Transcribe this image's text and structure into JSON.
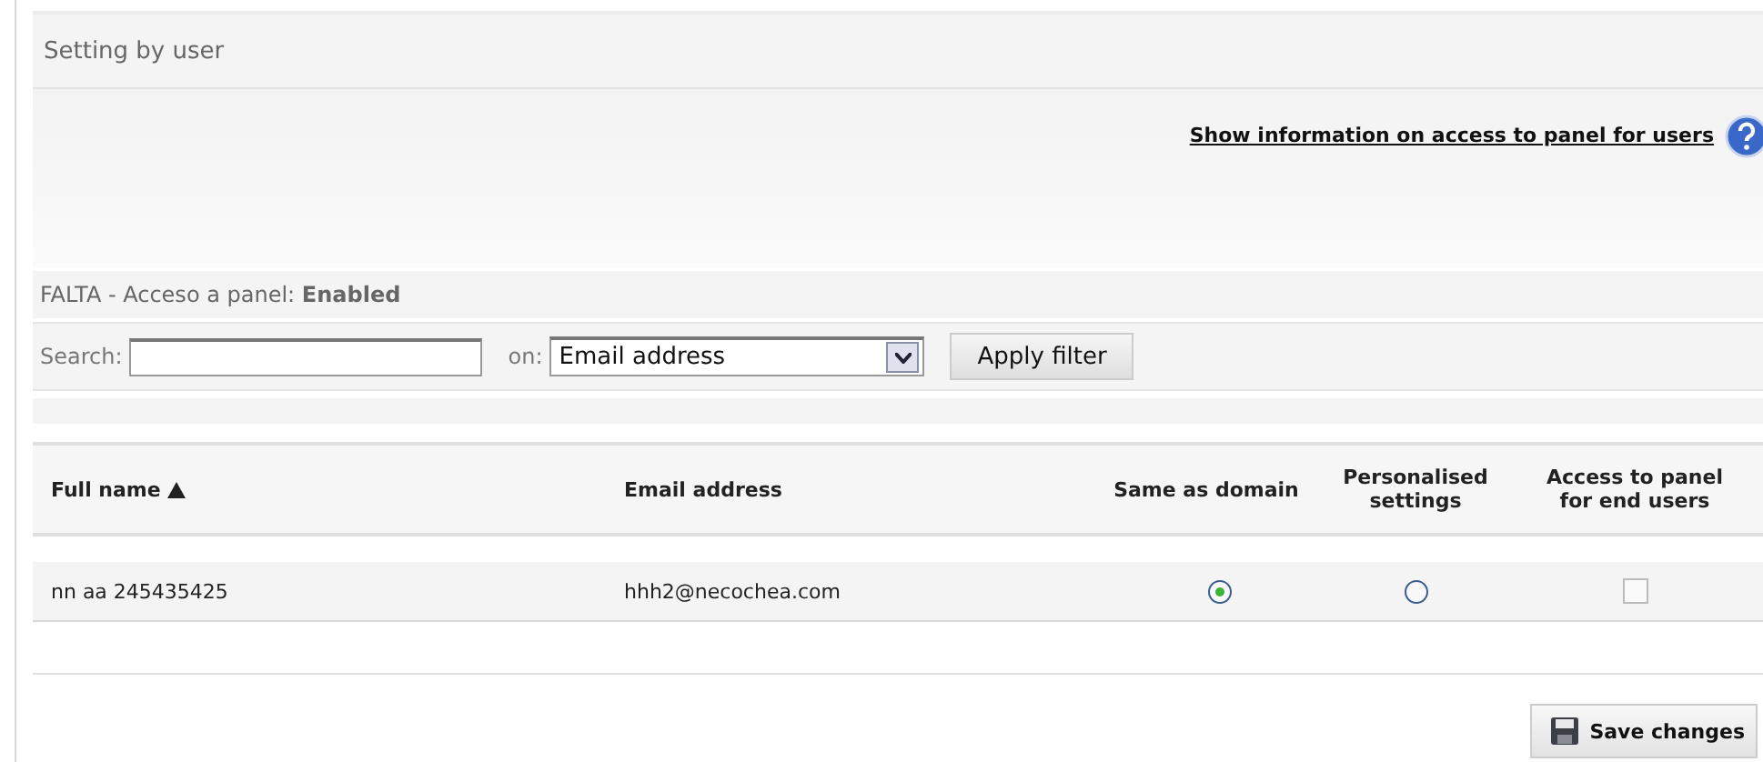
{
  "section_title": "Setting by user",
  "info_link": "Show information on access to panel for users",
  "status": {
    "label": "FALTA - Acceso a panel: ",
    "value": "Enabled"
  },
  "filter": {
    "search_label": "Search:",
    "on_label": "on:",
    "field": "Email address",
    "apply": "Apply filter"
  },
  "table": {
    "columns": [
      {
        "label": "Full name",
        "sorted": true
      },
      {
        "label": "Email address",
        "sorted": false
      },
      {
        "label": "Same as domain",
        "sorted": false
      },
      {
        "label": "Personalised settings",
        "sorted": false
      },
      {
        "label": "Access to panel for end users",
        "sorted": false
      }
    ],
    "rows": [
      {
        "full_name": "nn aa 245435425",
        "email": "hhh2@necochea.com",
        "same_as_domain": {
          "selected": true
        },
        "personalised": {
          "selected": false
        },
        "access_panel": {
          "checked": false
        }
      }
    ]
  },
  "save_button": "Save changes"
}
